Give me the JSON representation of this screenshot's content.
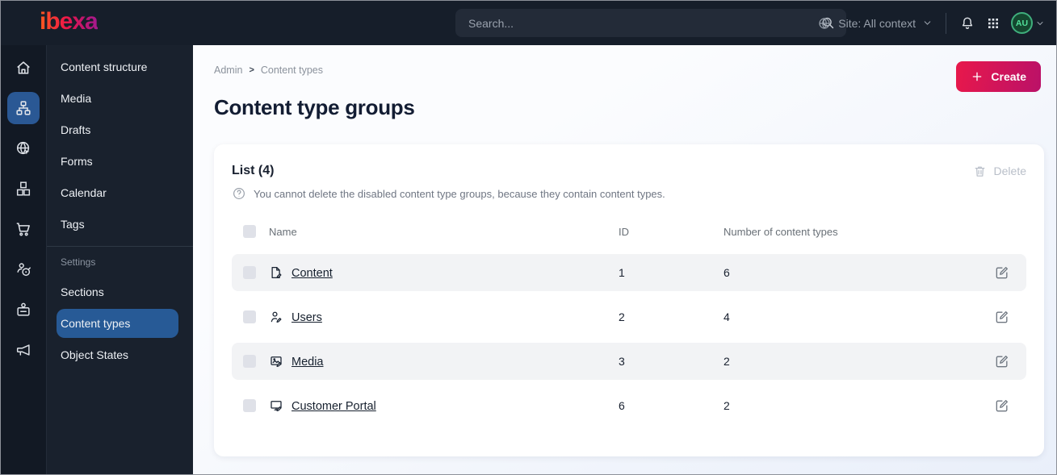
{
  "topbar": {
    "logo_text": "ibexa",
    "search": {
      "placeholder": "Search..."
    },
    "site_selector": {
      "label": "Site: All context"
    },
    "avatar_initials": "AU"
  },
  "sidebar": {
    "rail_items": [
      {
        "icon": "home-icon",
        "active": false
      },
      {
        "icon": "content-tree-icon",
        "active": true
      },
      {
        "icon": "site-icon",
        "active": false
      },
      {
        "icon": "products-icon",
        "active": false
      },
      {
        "icon": "cart-icon",
        "active": false
      },
      {
        "icon": "personalization-icon",
        "active": false
      },
      {
        "icon": "company-icon",
        "active": false
      },
      {
        "icon": "megaphone-icon",
        "active": false
      }
    ],
    "menu": {
      "items": [
        {
          "label": "Content structure"
        },
        {
          "label": "Media"
        },
        {
          "label": "Drafts"
        },
        {
          "label": "Forms"
        },
        {
          "label": "Calendar"
        },
        {
          "label": "Tags"
        }
      ],
      "section_label": "Settings",
      "settings_items": [
        {
          "label": "Sections",
          "active": false
        },
        {
          "label": "Content types",
          "active": true
        },
        {
          "label": "Object States",
          "active": false
        }
      ]
    }
  },
  "breadcrumb": {
    "items": [
      "Admin",
      "Content types"
    ],
    "separator": ">"
  },
  "page": {
    "title": "Content type groups",
    "create_label": "Create"
  },
  "list_panel": {
    "title": "List (4)",
    "hint": "You cannot delete the disabled content type groups, because they contain content types.",
    "delete_label": "Delete",
    "table": {
      "columns": {
        "name": "Name",
        "id": "ID",
        "count": "Number of content types"
      },
      "rows": [
        {
          "icon": "content-file-icon",
          "name": "Content",
          "id": "1",
          "count": "6"
        },
        {
          "icon": "user-icon",
          "name": "Users",
          "id": "2",
          "count": "4"
        },
        {
          "icon": "image-icon",
          "name": "Media",
          "id": "3",
          "count": "2"
        },
        {
          "icon": "monitor-icon",
          "name": "Customer Portal",
          "id": "6",
          "count": "2"
        }
      ]
    }
  },
  "colors": {
    "topbar_bg": "#161e2a",
    "rail_bg": "#121924",
    "sidebar_bg": "#19212d",
    "active_blue": "#2a5894",
    "accent_gradient_start": "#e8184b",
    "accent_gradient_end": "#ba1168",
    "avatar_green": "#3fae7c",
    "row_stripe": "#f2f3f5"
  }
}
